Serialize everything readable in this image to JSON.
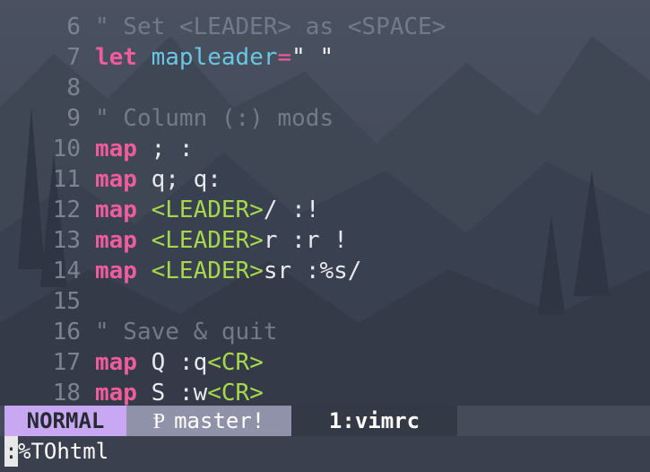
{
  "editor": {
    "lines": [
      {
        "num": "6",
        "comment": "\" Set <LEADER> as <SPACE>"
      },
      {
        "num": "7",
        "keyword": "let",
        "name": "mapleader",
        "op": "=",
        "value": "\" \""
      },
      {
        "num": "8"
      },
      {
        "num": "9",
        "comment": "\" Column (:) mods"
      },
      {
        "num": "10",
        "keyword": "map",
        "text": " ; :"
      },
      {
        "num": "11",
        "keyword": "map",
        "text": " q; q:"
      },
      {
        "num": "12",
        "keyword": "map",
        "key": "<LEADER>",
        "text": "/ :!"
      },
      {
        "num": "13",
        "keyword": "map",
        "key": "<LEADER>",
        "text": "r :r !"
      },
      {
        "num": "14",
        "keyword": "map",
        "key": "<LEADER>",
        "text": "sr :%s/"
      },
      {
        "num": "15"
      },
      {
        "num": "16",
        "comment": "\" Save & quit"
      },
      {
        "num": "17",
        "keyword": "map",
        "text": " Q :q",
        "key": "<CR>"
      },
      {
        "num": "18",
        "keyword": "map",
        "text": " S :w",
        "key": "<CR>"
      }
    ]
  },
  "statusline": {
    "mode": "NORMAL",
    "branch_icon": "git-branch-icon",
    "branch_glyph": "Ᵽ",
    "branch": "master!",
    "file": "1:vimrc"
  },
  "cmdline": {
    "cursor_char": ":",
    "text": "%TOhtml"
  },
  "colors": {
    "keyword": "#f05c9c",
    "identifier": "#69c7e3",
    "key_notation": "#a7d84b",
    "comment": "#737a88",
    "mode_bg": "#c8a8f2",
    "branch_bg": "#8f92a8"
  }
}
